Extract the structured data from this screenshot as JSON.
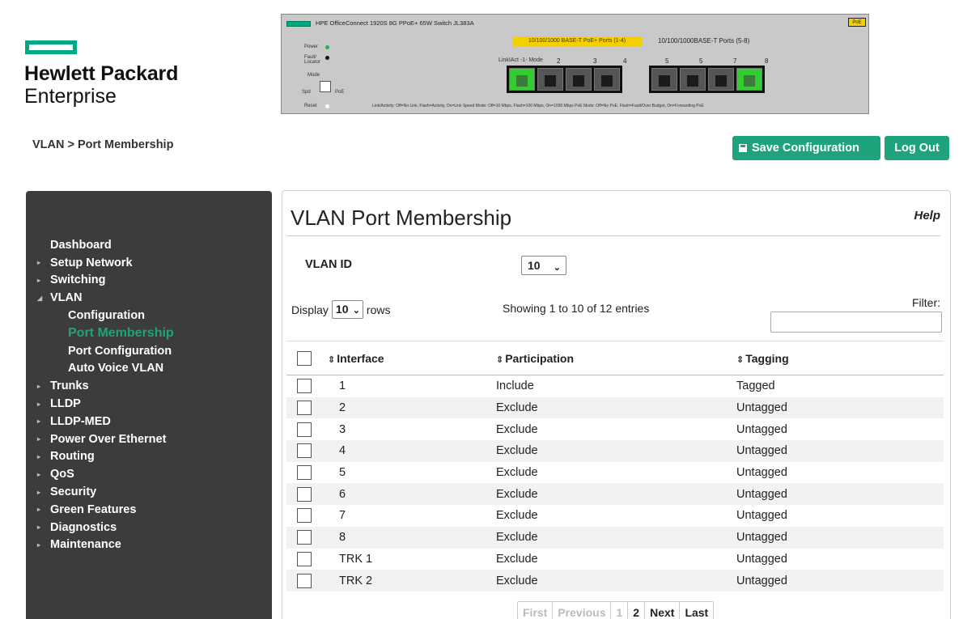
{
  "brand": {
    "line1": "Hewlett Packard",
    "line2": "Enterprise",
    "color": "#01a982"
  },
  "switch": {
    "title": "HPE OfficeConnect 1920S 8G PPoE+ 65W Switch",
    "model": "JL383A",
    "poe_icon": "PoE",
    "power_label": "Power",
    "fault_label": "Fault/\nLocator",
    "mode_label": "Mode",
    "spd_label": "Spd",
    "poe_label": "PoE",
    "reset_label": "Reset",
    "poe_ports_banner": "10/100/1000 BASE-T PoE+ Ports (1-4)",
    "ports_title": "10/100/1000BASE-T Ports (5-8)",
    "link_mode_label": "LinkIAct -1- Mode",
    "port_numbers": [
      "2",
      "3",
      "4",
      "5",
      "5",
      "7",
      "8"
    ],
    "footer": "Link/Activity: Off=No Link, Flash=Activity, On=Link   Speed Mode: Off=10 Mbps, Flash=100 Mbps, On=1000 Mbps   PoE Mode: Off=No PoE, Flash=Fault/Over Budget, On=Forwarding PoE"
  },
  "breadcrumb": "VLAN > Port Membership",
  "buttons": {
    "save": "Save Configuration",
    "logout": "Log Out"
  },
  "sidebar": {
    "items": [
      {
        "label": "Dashboard",
        "arrow": ""
      },
      {
        "label": "Setup Network",
        "arrow": "▸"
      },
      {
        "label": "Switching",
        "arrow": "▸"
      },
      {
        "label": "VLAN",
        "arrow": "◢"
      },
      {
        "label": "Configuration",
        "sub": true
      },
      {
        "label": "Port Membership",
        "sub": true,
        "active": true
      },
      {
        "label": "Port Configuration",
        "sub": true
      },
      {
        "label": "Auto Voice VLAN",
        "sub": true
      },
      {
        "label": "Trunks",
        "arrow": "▸"
      },
      {
        "label": "LLDP",
        "arrow": "▸"
      },
      {
        "label": "LLDP-MED",
        "arrow": "▸"
      },
      {
        "label": "Power Over Ethernet",
        "arrow": "▸"
      },
      {
        "label": "Routing",
        "arrow": "▸"
      },
      {
        "label": "QoS",
        "arrow": "▸"
      },
      {
        "label": "Security",
        "arrow": "▸"
      },
      {
        "label": "Green Features",
        "arrow": "▸"
      },
      {
        "label": "Diagnostics",
        "arrow": "▸"
      },
      {
        "label": "Maintenance",
        "arrow": "▸"
      }
    ]
  },
  "main": {
    "title": "VLAN Port Membership",
    "help": "Help",
    "vlan_id_label": "VLAN ID",
    "vlan_id_value": "10",
    "display_label": "Display",
    "rows_value": "10",
    "rows_label": "rows",
    "showing": "Showing 1 to 10 of 12 entries",
    "filter_label": "Filter:",
    "filter_value": "",
    "columns": {
      "interface": "Interface",
      "participation": "Participation",
      "tagging": "Tagging"
    },
    "rows": [
      {
        "interface": "1",
        "participation": "Include",
        "tagging": "Tagged"
      },
      {
        "interface": "2",
        "participation": "Exclude",
        "tagging": "Untagged"
      },
      {
        "interface": "3",
        "participation": "Exclude",
        "tagging": "Untagged"
      },
      {
        "interface": "4",
        "participation": "Exclude",
        "tagging": "Untagged"
      },
      {
        "interface": "5",
        "participation": "Exclude",
        "tagging": "Untagged"
      },
      {
        "interface": "6",
        "participation": "Exclude",
        "tagging": "Untagged"
      },
      {
        "interface": "7",
        "participation": "Exclude",
        "tagging": "Untagged"
      },
      {
        "interface": "8",
        "participation": "Exclude",
        "tagging": "Untagged"
      },
      {
        "interface": "TRK 1",
        "participation": "Exclude",
        "tagging": "Untagged"
      },
      {
        "interface": "TRK 2",
        "participation": "Exclude",
        "tagging": "Untagged"
      }
    ],
    "pager": {
      "first": "First",
      "previous": "Previous",
      "page1": "1",
      "page2": "2",
      "next": "Next",
      "last": "Last"
    }
  },
  "colors": {
    "accent": "#1ea37c",
    "sidebar_bg": "#3c3c3c"
  }
}
